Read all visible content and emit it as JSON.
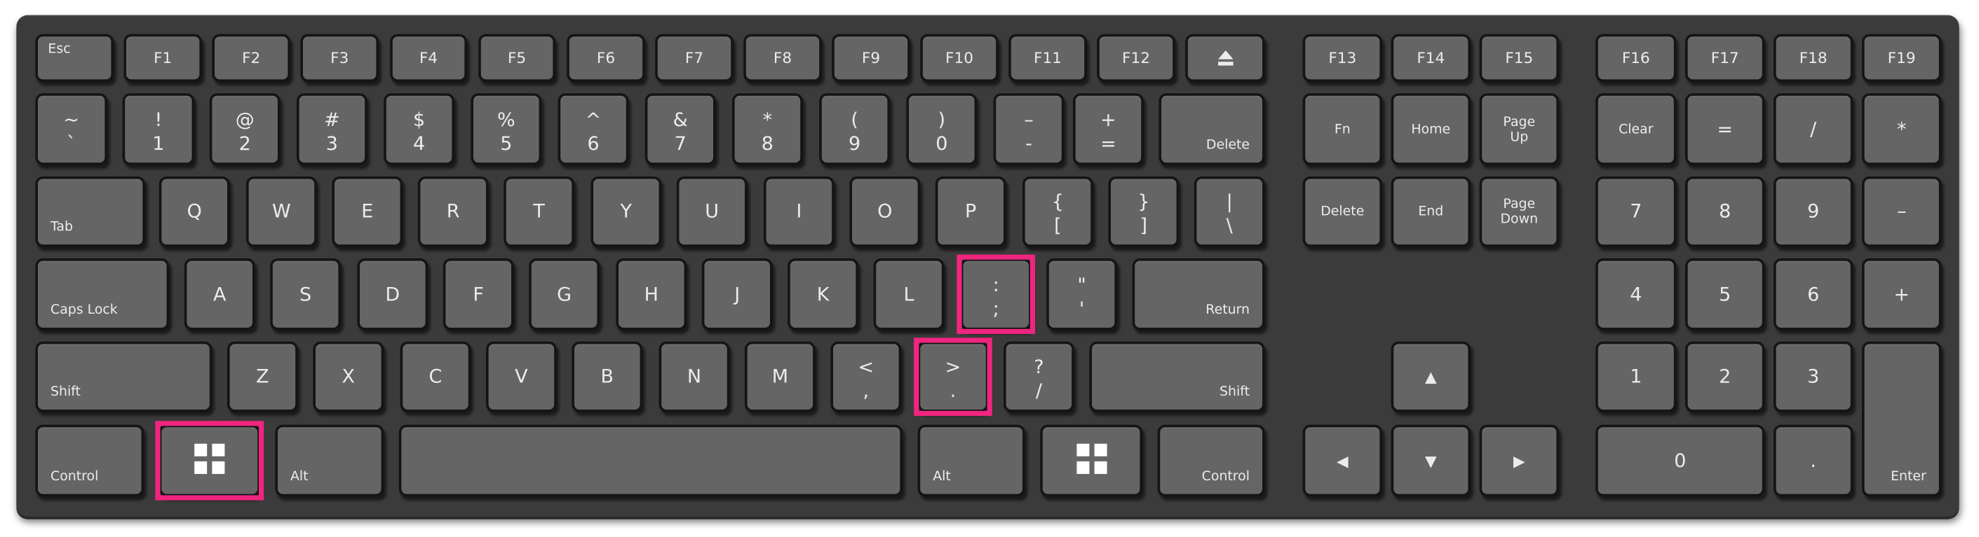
{
  "keyboard": {
    "colors": {
      "body": "#3b3b3b",
      "key": "#656565",
      "key_border": "#141414",
      "legend": "#ececec",
      "highlight": "#f0257f"
    },
    "highlighted_keys": [
      "win-left",
      "semicolon",
      "period"
    ],
    "keys": [
      {
        "id": "esc",
        "style": "tl",
        "label": "Esc"
      },
      {
        "id": "f1",
        "style": "fn",
        "label": "F1"
      },
      {
        "id": "f2",
        "style": "fn",
        "label": "F2"
      },
      {
        "id": "f3",
        "style": "fn",
        "label": "F3"
      },
      {
        "id": "f4",
        "style": "fn",
        "label": "F4"
      },
      {
        "id": "f5",
        "style": "fn",
        "label": "F5"
      },
      {
        "id": "f6",
        "style": "fn",
        "label": "F6"
      },
      {
        "id": "f7",
        "style": "fn",
        "label": "F7"
      },
      {
        "id": "f8",
        "style": "fn",
        "label": "F8"
      },
      {
        "id": "f9",
        "style": "fn",
        "label": "F9"
      },
      {
        "id": "f10",
        "style": "fn",
        "label": "F10"
      },
      {
        "id": "f11",
        "style": "fn",
        "label": "F11"
      },
      {
        "id": "f12",
        "style": "fn",
        "label": "F12"
      },
      {
        "id": "eject",
        "style": "icon",
        "icon": "eject-icon"
      },
      {
        "id": "f13",
        "style": "fn",
        "label": "F13"
      },
      {
        "id": "f14",
        "style": "fn",
        "label": "F14"
      },
      {
        "id": "f15",
        "style": "fn",
        "label": "F15"
      },
      {
        "id": "f16",
        "style": "fn",
        "label": "F16"
      },
      {
        "id": "f17",
        "style": "fn",
        "label": "F17"
      },
      {
        "id": "f18",
        "style": "fn",
        "label": "F18"
      },
      {
        "id": "f19",
        "style": "fn",
        "label": "F19"
      },
      {
        "id": "backtick",
        "style": "dual",
        "top": "~",
        "bottom": "`"
      },
      {
        "id": "1",
        "style": "dual",
        "top": "!",
        "bottom": "1"
      },
      {
        "id": "2",
        "style": "dual",
        "top": "@",
        "bottom": "2"
      },
      {
        "id": "3",
        "style": "dual",
        "top": "#",
        "bottom": "3"
      },
      {
        "id": "4",
        "style": "dual",
        "top": "$",
        "bottom": "4"
      },
      {
        "id": "5",
        "style": "dual",
        "top": "%",
        "bottom": "5"
      },
      {
        "id": "6",
        "style": "dual",
        "top": "^",
        "bottom": "6"
      },
      {
        "id": "7",
        "style": "dual",
        "top": "&",
        "bottom": "7"
      },
      {
        "id": "8",
        "style": "dual",
        "top": "*",
        "bottom": "8"
      },
      {
        "id": "9",
        "style": "dual",
        "top": "(",
        "bottom": "9"
      },
      {
        "id": "0",
        "style": "dual",
        "top": ")",
        "bottom": "0"
      },
      {
        "id": "minus",
        "style": "dual",
        "top": "–",
        "bottom": "-"
      },
      {
        "id": "equals",
        "style": "dual",
        "top": "+",
        "bottom": "="
      },
      {
        "id": "delete",
        "style": "br",
        "label": "Delete"
      },
      {
        "id": "fn",
        "style": "small",
        "label": "Fn"
      },
      {
        "id": "home",
        "style": "small",
        "label": "Home"
      },
      {
        "id": "page-up",
        "style": "two",
        "label": "Page\nUp"
      },
      {
        "id": "clear",
        "style": "small",
        "label": "Clear"
      },
      {
        "id": "num-equals",
        "style": "letter",
        "label": "="
      },
      {
        "id": "num-divide",
        "style": "letter",
        "label": "/"
      },
      {
        "id": "num-multiply",
        "style": "letter",
        "label": "*"
      },
      {
        "id": "tab",
        "style": "bl",
        "label": "Tab"
      },
      {
        "id": "q",
        "style": "letter",
        "label": "Q"
      },
      {
        "id": "w",
        "style": "letter",
        "label": "W"
      },
      {
        "id": "e",
        "style": "letter",
        "label": "E"
      },
      {
        "id": "r",
        "style": "letter",
        "label": "R"
      },
      {
        "id": "t",
        "style": "letter",
        "label": "T"
      },
      {
        "id": "y",
        "style": "letter",
        "label": "Y"
      },
      {
        "id": "u",
        "style": "letter",
        "label": "U"
      },
      {
        "id": "i",
        "style": "letter",
        "label": "I"
      },
      {
        "id": "o",
        "style": "letter",
        "label": "O"
      },
      {
        "id": "p",
        "style": "letter",
        "label": "P"
      },
      {
        "id": "lbracket",
        "style": "dual",
        "top": "{",
        "bottom": "["
      },
      {
        "id": "rbracket",
        "style": "dual",
        "top": "}",
        "bottom": "]"
      },
      {
        "id": "backslash",
        "style": "dual",
        "top": "|",
        "bottom": "\\"
      },
      {
        "id": "forward-delete",
        "style": "small",
        "label": "Delete"
      },
      {
        "id": "end",
        "style": "small",
        "label": "End"
      },
      {
        "id": "page-down",
        "style": "two",
        "label": "Page\nDown"
      },
      {
        "id": "num-7",
        "style": "letter",
        "label": "7"
      },
      {
        "id": "num-8",
        "style": "letter",
        "label": "8"
      },
      {
        "id": "num-9",
        "style": "letter",
        "label": "9"
      },
      {
        "id": "num-minus",
        "style": "letter",
        "label": "–"
      },
      {
        "id": "caps-lock",
        "style": "bl",
        "label": "Caps Lock"
      },
      {
        "id": "a",
        "style": "letter",
        "label": "A"
      },
      {
        "id": "s",
        "style": "letter",
        "label": "S"
      },
      {
        "id": "d",
        "style": "letter",
        "label": "D"
      },
      {
        "id": "f",
        "style": "letter",
        "label": "F"
      },
      {
        "id": "g",
        "style": "letter",
        "label": "G"
      },
      {
        "id": "h",
        "style": "letter",
        "label": "H"
      },
      {
        "id": "j",
        "style": "letter",
        "label": "J"
      },
      {
        "id": "k",
        "style": "letter",
        "label": "K"
      },
      {
        "id": "l",
        "style": "letter",
        "label": "L"
      },
      {
        "id": "semicolon",
        "style": "dual",
        "top": ":",
        "bottom": ";"
      },
      {
        "id": "quote",
        "style": "dual",
        "top": "\"",
        "bottom": "'"
      },
      {
        "id": "return",
        "style": "br",
        "label": "Return"
      },
      {
        "id": "num-4",
        "style": "letter",
        "label": "4"
      },
      {
        "id": "num-5",
        "style": "letter",
        "label": "5"
      },
      {
        "id": "num-6",
        "style": "letter",
        "label": "6"
      },
      {
        "id": "num-plus",
        "style": "letter",
        "label": "+"
      },
      {
        "id": "shift-left",
        "style": "bl",
        "label": "Shift"
      },
      {
        "id": "z",
        "style": "letter",
        "label": "Z"
      },
      {
        "id": "x",
        "style": "letter",
        "label": "X"
      },
      {
        "id": "c",
        "style": "letter",
        "label": "C"
      },
      {
        "id": "v",
        "style": "letter",
        "label": "V"
      },
      {
        "id": "b",
        "style": "letter",
        "label": "B"
      },
      {
        "id": "n",
        "style": "letter",
        "label": "N"
      },
      {
        "id": "m",
        "style": "letter",
        "label": "M"
      },
      {
        "id": "comma",
        "style": "dual",
        "top": "<",
        "bottom": ","
      },
      {
        "id": "period",
        "style": "dual",
        "top": ">",
        "bottom": "."
      },
      {
        "id": "slash",
        "style": "dual",
        "top": "?",
        "bottom": "/"
      },
      {
        "id": "shift-right",
        "style": "br",
        "label": "Shift"
      },
      {
        "id": "arrow-up",
        "style": "arrow",
        "label": "▲"
      },
      {
        "id": "num-1",
        "style": "letter",
        "label": "1"
      },
      {
        "id": "num-2",
        "style": "letter",
        "label": "2"
      },
      {
        "id": "num-3",
        "style": "letter",
        "label": "3"
      },
      {
        "id": "num-enter",
        "style": "br",
        "label": "Enter"
      },
      {
        "id": "control-left",
        "style": "bl",
        "label": "Control"
      },
      {
        "id": "win-left",
        "style": "icon",
        "icon": "windows-logo-icon"
      },
      {
        "id": "alt-left",
        "style": "bl",
        "label": "Alt"
      },
      {
        "id": "space",
        "style": "blank"
      },
      {
        "id": "alt-right",
        "style": "bl",
        "label": "Alt"
      },
      {
        "id": "win-right",
        "style": "icon",
        "icon": "windows-logo-icon"
      },
      {
        "id": "control-right",
        "style": "br",
        "label": "Control"
      },
      {
        "id": "arrow-left",
        "style": "arrow",
        "label": "◀"
      },
      {
        "id": "arrow-down",
        "style": "arrow",
        "label": "▼"
      },
      {
        "id": "arrow-right",
        "style": "arrow",
        "label": "▶"
      },
      {
        "id": "num-0",
        "style": "letter",
        "label": "0"
      },
      {
        "id": "num-decimal",
        "style": "letter",
        "label": "."
      }
    ]
  }
}
